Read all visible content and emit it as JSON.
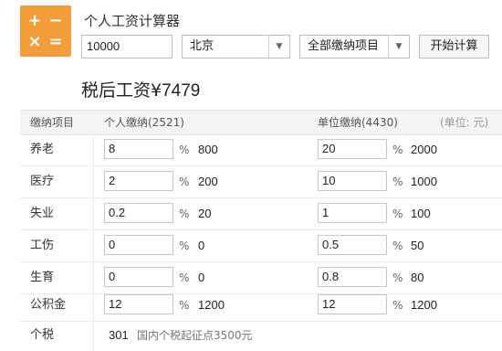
{
  "app": {
    "title": "个人工资计算器",
    "logo_glyphs": [
      "+",
      "−",
      "×",
      "="
    ]
  },
  "controls": {
    "salary_value": "10000",
    "city_value": "北京",
    "scope_value": "全部缴纳项目",
    "calc_button": "开始计算"
  },
  "result": {
    "label": "税后工资",
    "currency": "¥",
    "amount": "7479"
  },
  "table": {
    "header": {
      "item": "缴纳项目",
      "personal": "个人缴纳(2521)",
      "company": "单位缴纳(4430)",
      "unit": "(单位: 元)"
    },
    "pct_symbol": "%",
    "rows": [
      {
        "name": "养老",
        "p_rate": "8",
        "p_amt": "800",
        "c_rate": "20",
        "c_amt": "2000"
      },
      {
        "name": "医疗",
        "p_rate": "2",
        "p_amt": "200",
        "c_rate": "10",
        "c_amt": "1000"
      },
      {
        "name": "失业",
        "p_rate": "0.2",
        "p_amt": "20",
        "c_rate": "1",
        "c_amt": "100"
      },
      {
        "name": "工伤",
        "p_rate": "0",
        "p_amt": "0",
        "c_rate": "0.5",
        "c_amt": "50"
      },
      {
        "name": "生育",
        "p_rate": "0",
        "p_amt": "0",
        "c_rate": "0.8",
        "c_amt": "80"
      },
      {
        "name": "公积金",
        "p_rate": "12",
        "p_amt": "1200",
        "c_rate": "12",
        "c_amt": "1200"
      }
    ],
    "tax": {
      "name": "个税",
      "amount": "301",
      "note": "国内个税起征点3500元"
    }
  },
  "colors": {
    "logo_bg": "#f39c3a"
  }
}
